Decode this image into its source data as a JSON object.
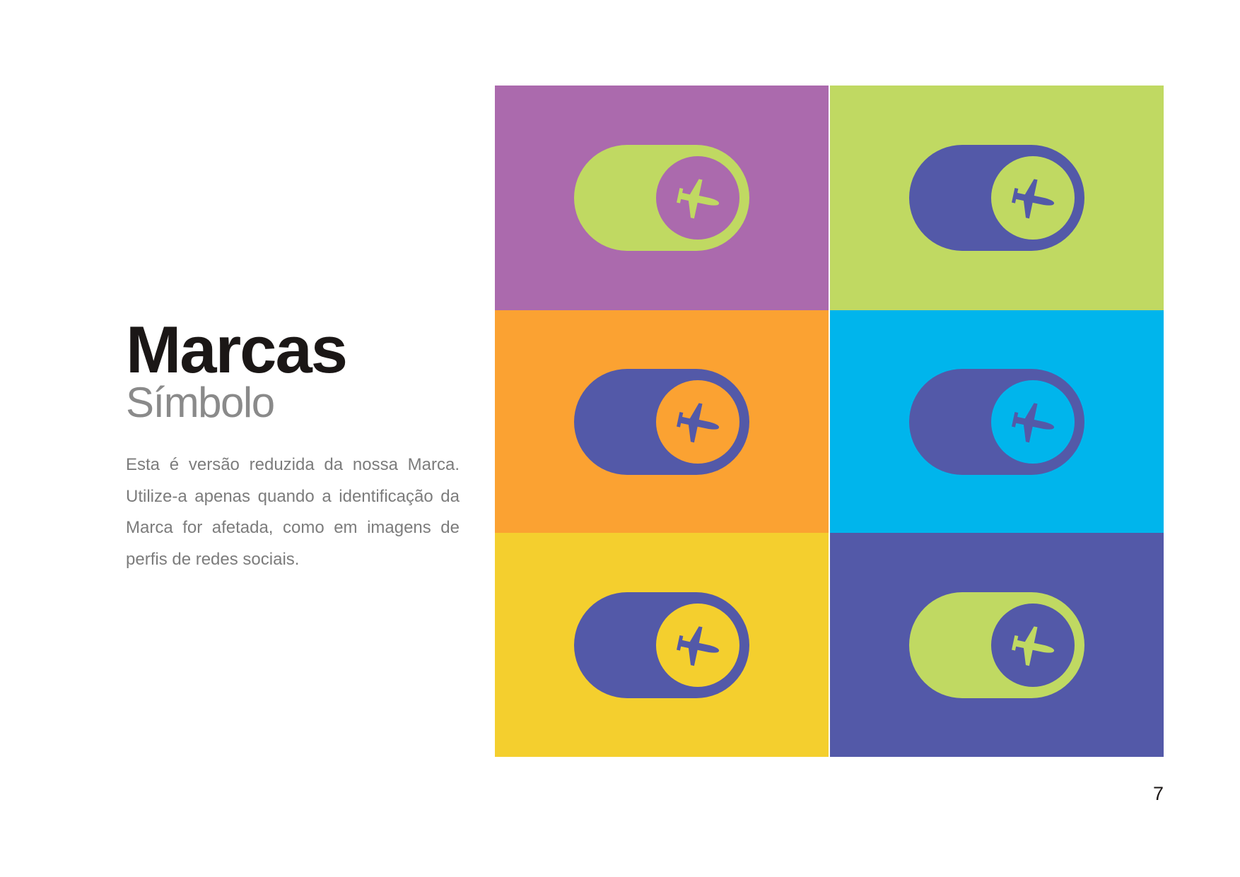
{
  "heading": {
    "title": "Marcas",
    "subtitle": "Símbolo"
  },
  "description": "Esta é versão reduzida da nossa Marca. Utilize-a apenas quando a identificação da Marca for afetada, como em imagens de perfis de redes sociais.",
  "symbol_icon": "airplane-toggle-icon",
  "palette": {
    "purple": "#ab6aad",
    "lime": "#c0d962",
    "orange": "#fba232",
    "cyan": "#00b5ec",
    "yellow": "#f4cf2e",
    "indigo": "#5359a8"
  },
  "symbol_variants": [
    {
      "background": "#ab6aad",
      "pill": "#c0d962",
      "knob": "#ab6aad",
      "plane": "#c0d962"
    },
    {
      "background": "#c0d962",
      "pill": "#5359a8",
      "knob": "#c0d962",
      "plane": "#5359a8"
    },
    {
      "background": "#fba232",
      "pill": "#5359a8",
      "knob": "#fba232",
      "plane": "#5359a8"
    },
    {
      "background": "#00b5ec",
      "pill": "#5359a8",
      "knob": "#00b5ec",
      "plane": "#5359a8"
    },
    {
      "background": "#f4cf2e",
      "pill": "#5359a8",
      "knob": "#f4cf2e",
      "plane": "#5359a8"
    },
    {
      "background": "#5359a8",
      "pill": "#c0d962",
      "knob": "#5359a8",
      "plane": "#c0d962"
    }
  ],
  "page_number": "7"
}
